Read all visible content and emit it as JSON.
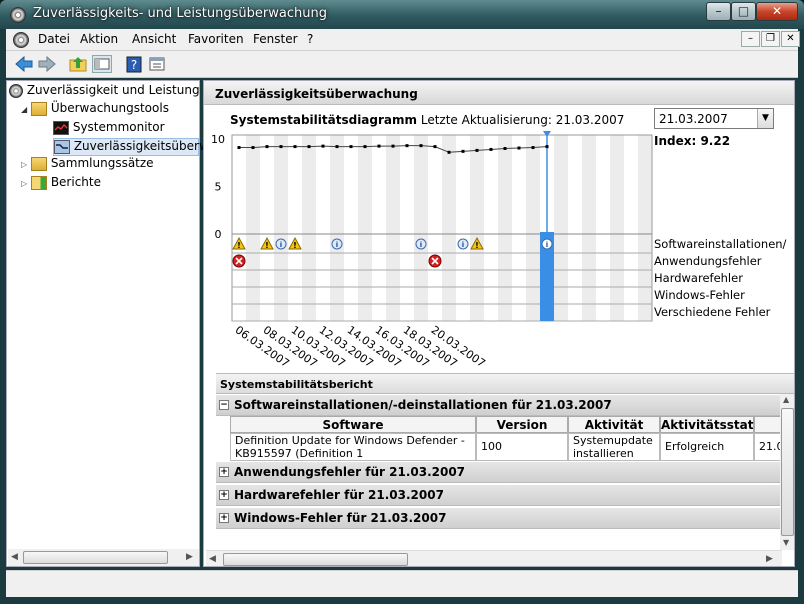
{
  "window": {
    "title": "Zuverlässigkeits- und Leistungsüberwachung"
  },
  "caption_buttons": {
    "minimize": "–",
    "maximize": "□",
    "close": "✕"
  },
  "menu": [
    "Datei",
    "Aktion",
    "Ansicht",
    "Favoriten",
    "Fenster",
    "?"
  ],
  "mdi_buttons": {
    "minimize": "–",
    "restore": "❐",
    "close": "✕"
  },
  "toolbar": {
    "icons": [
      "back-arrow-icon",
      "forward-arrow-icon",
      "up-folder-icon",
      "console-tree-icon",
      "help-icon",
      "properties-icon"
    ]
  },
  "tree": {
    "root": "Zuverlässigkeit und Leistung",
    "items": [
      {
        "label": "Überwachungstools",
        "icon": "folder-tools-icon"
      },
      {
        "label": "Systemmonitor",
        "icon": "monitor-icon"
      },
      {
        "label": "Zuverlässigkeitsüberwa",
        "icon": "reliability-icon"
      },
      {
        "label": "Sammlungssätze",
        "icon": "collection-folder-icon"
      },
      {
        "label": "Berichte",
        "icon": "reports-folder-icon"
      }
    ]
  },
  "panel": {
    "header": "Zuverlässigkeitsüberwachung",
    "diagram_title": "Systemstabilitätsdiagramm",
    "last_update": "Letzte Aktualisierung: 21.03.2007",
    "date_select": "21.03.2007",
    "index": "Index: 9.22"
  },
  "chart_data": {
    "type": "line",
    "ylim": [
      0,
      10
    ],
    "yticks": [
      "10",
      "5",
      "0"
    ],
    "x_labels": [
      "06.03.2007",
      "08.03.2007",
      "10.03.2007",
      "12.03.2007",
      "14.03.2007",
      "16.03.2007",
      "18.03.2007",
      "20.03.2007"
    ],
    "stability_values": [
      9.1,
      9.1,
      9.2,
      9.2,
      9.2,
      9.2,
      9.25,
      9.2,
      9.2,
      9.2,
      9.25,
      9.25,
      9.3,
      9.3,
      9.2,
      8.6,
      8.7,
      8.8,
      8.9,
      9.0,
      9.05,
      9.1,
      9.2
    ],
    "selected_day": 22,
    "event_rows": [
      "Softwareinstallationen/",
      "Anwendungsfehler",
      "Hardwarefehler",
      "Windows-Fehler",
      "Verschiedene Fehler"
    ],
    "software_events": [
      {
        "day": 0,
        "kind": "warning"
      },
      {
        "day": 2,
        "kind": "warning"
      },
      {
        "day": 3,
        "kind": "info"
      },
      {
        "day": 4,
        "kind": "warning"
      },
      {
        "day": 7,
        "kind": "info"
      },
      {
        "day": 13,
        "kind": "info"
      },
      {
        "day": 16,
        "kind": "info"
      },
      {
        "day": 17,
        "kind": "warning"
      },
      {
        "day": 22,
        "kind": "info"
      }
    ],
    "application_errors": [
      {
        "day": 0
      },
      {
        "day": 14
      }
    ]
  },
  "report": {
    "title": "Systemstabilitätsbericht",
    "sections": [
      {
        "label": "Softwareinstallationen/-deinstallationen für 21.03.2007",
        "expanded": true,
        "sign": "−"
      },
      {
        "label": "Anwendungsfehler für 21.03.2007",
        "expanded": false,
        "sign": "+"
      },
      {
        "label": "Hardwarefehler für 21.03.2007",
        "expanded": false,
        "sign": "+"
      },
      {
        "label": "Windows-Fehler für 21.03.2007",
        "expanded": false,
        "sign": "+"
      }
    ],
    "table": {
      "headers": [
        "Software",
        "Version",
        "Aktivität",
        "Aktivitätsstatus"
      ],
      "row": [
        "Definition Update for Windows Defender - KB915597 (Definition 1",
        "100",
        "Systemupdate installieren",
        "Erfolgreich",
        "21.0"
      ]
    }
  },
  "colors": {
    "accent": "#3a8ee6",
    "warning": "#f2c318",
    "error": "#d42020"
  }
}
